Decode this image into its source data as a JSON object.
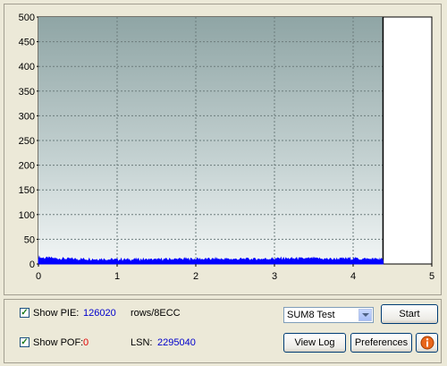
{
  "chart_data": {
    "type": "area",
    "x_ticks": [
      "0",
      "1",
      "2",
      "3",
      "4",
      "5"
    ],
    "y_ticks": [
      "0",
      "50",
      "100",
      "150",
      "200",
      "250",
      "300",
      "350",
      "400",
      "450",
      "500"
    ],
    "xlim": [
      0,
      5
    ],
    "ylim": [
      0,
      500
    ],
    "scan_end_x": 4.38,
    "series": [
      {
        "color": "#0000ff",
        "x": [
          0,
          0.25,
          0.5,
          0.75,
          1,
          1.25,
          1.5,
          1.75,
          2,
          2.25,
          2.5,
          2.75,
          3,
          3.25,
          3.5,
          3.75,
          4,
          4.25,
          4.38
        ],
        "y": [
          12,
          10,
          9,
          9,
          8,
          8,
          8,
          9,
          9,
          9,
          9,
          9,
          10,
          10,
          10,
          9,
          10,
          9,
          8
        ]
      }
    ],
    "grid": true
  },
  "controls": {
    "pie": {
      "label": "Show PIE:",
      "value": "126020",
      "unit": "rows/8ECC",
      "checked": true
    },
    "pof": {
      "label": "Show POF:",
      "value": "0",
      "checked": true
    },
    "lsn": {
      "label": "LSN:",
      "value": "2295040"
    },
    "test_select": {
      "value": "SUM8 Test"
    },
    "start_label": "Start",
    "view_log_label": "View Log",
    "preferences_label": "Preferences",
    "info_icon": "info-icon"
  }
}
